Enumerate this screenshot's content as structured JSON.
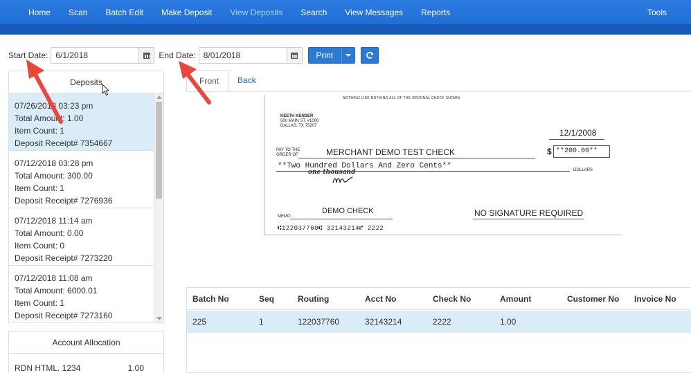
{
  "nav": {
    "items": [
      "Home",
      "Scan",
      "Batch Edit",
      "Make Deposit",
      "View Deposits",
      "Search",
      "View Messages",
      "Reports"
    ],
    "active": "View Deposits",
    "tools": "Tools"
  },
  "filters": {
    "start_label": "Start Date:",
    "start_value": "6/1/2018",
    "end_label": "End Date:",
    "end_value": "8/01/2018",
    "print_label": "Print",
    "refresh_icon": "refresh-icon"
  },
  "deposits": {
    "title": "Deposits",
    "items": [
      {
        "date": "07/26/2018 03:23 pm",
        "amount": "Total Amount: 1.00",
        "count": "Item Count: 1",
        "receipt": "Deposit Receipt# 7354667"
      },
      {
        "date": "07/12/2018 03:28 pm",
        "amount": "Total Amount: 300.00",
        "count": "Item Count: 1",
        "receipt": "Deposit Receipt# 7276936"
      },
      {
        "date": "07/12/2018 11:14 am",
        "amount": "Total Amount: 0.00",
        "count": "Item Count: 0",
        "receipt": "Deposit Receipt# 7273220"
      },
      {
        "date": "07/12/2018 11:08 am",
        "amount": "Total Amount: 6000.01",
        "count": "Item Count: 1",
        "receipt": "Deposit Receipt# 7273160"
      }
    ]
  },
  "allocation": {
    "title": "Account Allocation",
    "rows": [
      {
        "name": "RDN HTML. 1234",
        "amount": "1.00"
      }
    ]
  },
  "tabs": [
    "Front",
    "Back"
  ],
  "check": {
    "header_text": "NOTHING LIKE NOTHING ALL OF THE ORIGINAL CHECK SHOWN",
    "payer_name": "KEETH KENDER",
    "payer_addr1": "500 MAIN ST. #1000",
    "payer_addr2": "DALLAS, TX 75207",
    "date": "12/1/2008",
    "pay_to_label1": "PAY TO THE",
    "pay_to_label2": "ORDER OF",
    "payee": "MERCHANT DEMO TEST CHECK",
    "dollar_sign": "$",
    "amount_box": "**200.00**",
    "written_amount": "**Two Hundred Dollars And Zero Cents**",
    "handwritten": "one thousand",
    "dollars_label": "DOLLARS",
    "memo_label": "MEMO",
    "memo_text": "DEMO CHECK",
    "signature_note": "NO SIGNATURE REQUIRED",
    "micr": "⑆122037760⑆ 32143214⑈ 2222"
  },
  "grid": {
    "headers": [
      "Batch No",
      "Seq",
      "Routing",
      "Acct No",
      "Check No",
      "Amount",
      "Customer No",
      "Invoice No"
    ],
    "rows": [
      [
        "225",
        "1",
        "122037760",
        "32143214",
        "2222",
        "1.00",
        "",
        ""
      ]
    ]
  },
  "colors": {
    "nav_bg": "#1f6fd6",
    "button": "#2a7ad6",
    "selected_row": "#d9ecf7",
    "arrow": "#e8473a"
  }
}
